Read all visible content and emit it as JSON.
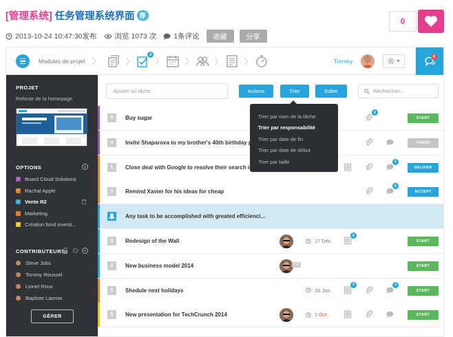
{
  "post": {
    "category": "[管理系统]",
    "title": "任务管理系统界面",
    "badge": "荐",
    "date": "2013-10-24 10:47:30发布",
    "views": "浏览 1073 次",
    "comments": "1条评论",
    "collect_label": "收藏",
    "share_label": "分享",
    "likes": "0"
  },
  "app": {
    "modules_label": "Modules de projet",
    "nav_badge": "3",
    "user_name": "Tommy",
    "messages_count": "6"
  },
  "sidebar": {
    "project_heading": "PROJET",
    "project_name": "Refonte de la homepage",
    "options_heading": "OPTIONS",
    "options": [
      {
        "label": "Board Cloud Solutions",
        "color": "#9b59b6",
        "checked": true
      },
      {
        "label": "Rachat Apple",
        "color": "#e67e22",
        "checked": true
      },
      {
        "label": "Vente R2",
        "color": "#26a4db",
        "checked": true
      },
      {
        "label": "Marketing",
        "color": "#e67e22",
        "checked": false
      },
      {
        "label": "Création fond investi...",
        "color": "#f1c40f",
        "checked": true
      }
    ],
    "contributors_heading": "CONTRIBUTEURS",
    "contributors": [
      "Steve Jobs",
      "Tommy Roussel",
      "Lionel Roux",
      "Baptiste Lacroix"
    ],
    "manage_label": "GÉRER"
  },
  "toolbar": {
    "add_placeholder": "Ajouter un tâche",
    "actions_label": "Actions",
    "sort_label": "Trier",
    "edit_label": "Editer",
    "search_placeholder": "Rechercher..."
  },
  "sort_menu": [
    "Trier par nom de la tâche",
    "Trier par responsabilité",
    "Trier par date de fin",
    "Trier par date de début",
    "Trier par taille"
  ],
  "tasks": [
    {
      "num": "5",
      "title": "Buy sugar",
      "bar": "#9b59b6",
      "status": "START",
      "status_color": "#5cb85c",
      "attach_count": "2",
      "chat_count": ""
    },
    {
      "num": "4",
      "title": "Invite Shaparova to my brother's 40th birthday p...",
      "bar": "#9b59b6",
      "status": "FINISH",
      "status_color": "#c4c4c4",
      "chat_count": ""
    },
    {
      "num": "1",
      "title": "Close deal with Google to resolve their search is...",
      "bar": "#e67e22",
      "status": "DELIVER",
      "status_color": "#26a4db",
      "chat_count": "1"
    },
    {
      "num": "5",
      "title": "Remind Xavier for his ideas for cheap",
      "bar": "#e67e22",
      "status": "ACCEPT",
      "status_color": "#26a4db",
      "chat_count": "6"
    },
    {
      "num": "",
      "title": "Any task to be accomplished with greated efficienci...",
      "bar": "#26a4db"
    },
    {
      "num": "3",
      "title": "Redesign of the Wall",
      "bar": "#26a4db",
      "date": "17 Déc.",
      "date_red": false,
      "note_count": "6",
      "status": "START",
      "status_color": "#5cb85c"
    },
    {
      "num": "2",
      "title": "New business model 2014",
      "bar": "#26a4db",
      "extra": "+2",
      "status": "START",
      "status_color": "#5cb85c"
    },
    {
      "num": "5",
      "title": "Shedule next holidays",
      "bar": "#e67e22",
      "date": "10 Jan.",
      "date_red": false,
      "note_count": "2",
      "chat_count": "3",
      "status": "START",
      "status_color": "#5cb85c"
    },
    {
      "num": "5",
      "title": "New presentation for TechCrunch 2014",
      "bar": "#f1c40f",
      "date": "1 Oct.",
      "date_red": true,
      "status": "START",
      "status_color": "#5cb85c"
    }
  ],
  "colors": {
    "accent": "#26a4db",
    "brand": "#e73d8f",
    "sidebar": "#2f3338",
    "highlight_row": "#d2e9f4"
  }
}
